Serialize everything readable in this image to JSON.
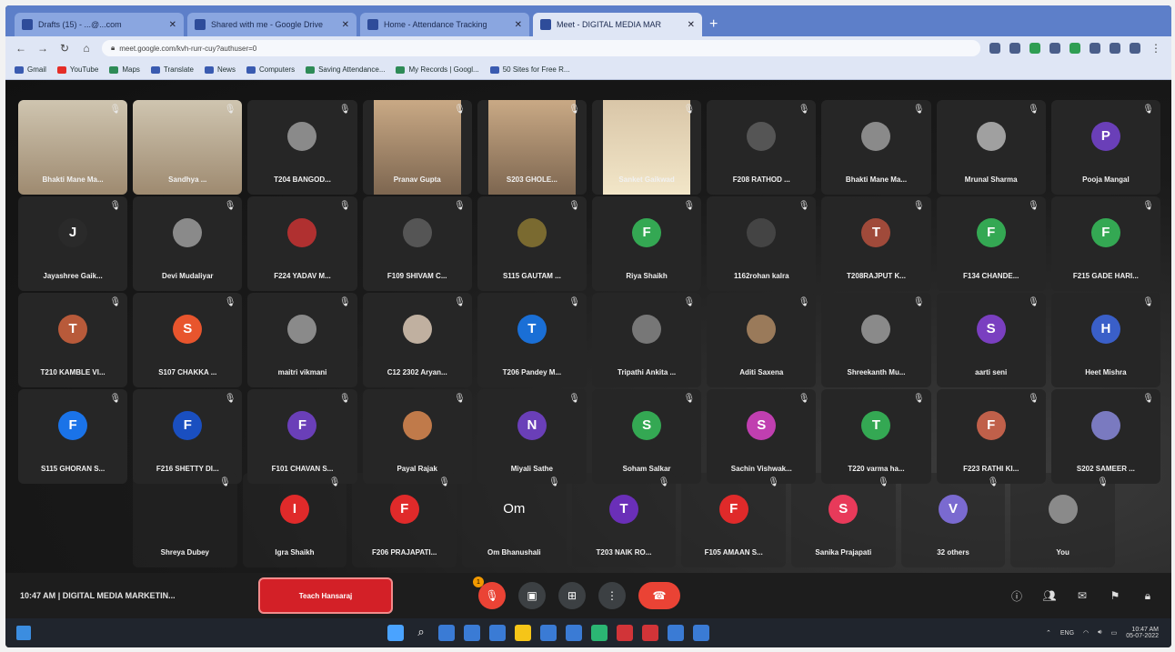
{
  "browser": {
    "tabs": [
      {
        "title": "Drafts (15) - ...@...com",
        "active": false
      },
      {
        "title": "Shared with me - Google Drive",
        "active": false
      },
      {
        "title": "Home - Attendance Tracking",
        "active": false
      },
      {
        "title": "Meet - DIGITAL MEDIA MAR",
        "active": true
      }
    ],
    "new_tab": "+",
    "url": "meet.google.com/kvh-rurr-cuy?authuser=0",
    "bookmarks": [
      "Gmail",
      "YouTube",
      "Maps",
      "Translate",
      "News",
      "Computers",
      "Saving Attendance...",
      "My Records | Googl...",
      "50 Sites for Free R..."
    ]
  },
  "participants_rows": [
    [
      {
        "name": "Bhakti Mane Ma...",
        "kind": "video",
        "style": "wide"
      },
      {
        "name": "Sandhya ...",
        "kind": "video",
        "style": "wide"
      },
      {
        "name": "T204 BANGOD...",
        "kind": "avatar",
        "letter": "",
        "color": "#8a8a8a"
      },
      {
        "name": "Pranav Gupta",
        "kind": "video",
        "style": "plain"
      },
      {
        "name": "S203 GHOLE...",
        "kind": "video",
        "style": "plain"
      },
      {
        "name": "Sanket Gaikwad",
        "kind": "video",
        "style": "face"
      },
      {
        "name": "F208 RATHOD ...",
        "kind": "avatar",
        "letter": "",
        "color": "#555555"
      },
      {
        "name": "Bhakti Mane Ma...",
        "kind": "avatar",
        "letter": "",
        "color": "#8a8a8a"
      },
      {
        "name": "Mrunal Sharma",
        "kind": "avatar",
        "letter": "",
        "color": "#a0a0a0"
      },
      {
        "name": "Pooja Mangal",
        "kind": "avatar",
        "letter": "P",
        "color": "#6a3fb8"
      }
    ],
    [
      {
        "name": "Jayashree Gaik...",
        "kind": "avatar",
        "letter": "J",
        "color": "#2a2a2a"
      },
      {
        "name": "Devi Mudaliyar",
        "kind": "avatar",
        "letter": "",
        "color": "#8a8a8a"
      },
      {
        "name": "F224 YADAV M...",
        "kind": "avatar",
        "letter": "",
        "color": "#b03030"
      },
      {
        "name": "F109 SHIVAM C...",
        "kind": "avatar",
        "letter": "",
        "color": "#555555"
      },
      {
        "name": "S115 GAUTAM ...",
        "kind": "avatar",
        "letter": "",
        "color": "#7a6a30"
      },
      {
        "name": "Riya Shaikh",
        "kind": "avatar",
        "letter": "F",
        "color": "#34a853"
      },
      {
        "name": "1162rohan kalra",
        "kind": "avatar",
        "letter": "",
        "color": "#444444"
      },
      {
        "name": "T208RAJPUT K...",
        "kind": "avatar",
        "letter": "T",
        "color": "#a04a3a"
      },
      {
        "name": "F134 CHANDE...",
        "kind": "avatar",
        "letter": "F",
        "color": "#34a853"
      },
      {
        "name": "F215 GADE HARI...",
        "kind": "avatar",
        "letter": "F",
        "color": "#34a853"
      }
    ],
    [
      {
        "name": "T210 KAMBLE VI...",
        "kind": "avatar",
        "letter": "T",
        "color": "#b85a3a"
      },
      {
        "name": "S107 CHAKKA ...",
        "kind": "avatar",
        "letter": "S",
        "color": "#e8552d"
      },
      {
        "name": "maitri vikmani",
        "kind": "avatar",
        "letter": "",
        "color": "#8a8a8a"
      },
      {
        "name": "C12 2302 Aryan...",
        "kind": "avatar",
        "letter": "",
        "color": "#c0b0a0"
      },
      {
        "name": "T206 Pandey M...",
        "kind": "avatar",
        "letter": "T",
        "color": "#1a6fd6"
      },
      {
        "name": "Tripathi Ankita ...",
        "kind": "avatar",
        "letter": "",
        "color": "#777777"
      },
      {
        "name": "Aditi Saxena",
        "kind": "avatar",
        "letter": "",
        "color": "#9a7a5a"
      },
      {
        "name": "Shreekanth Mu...",
        "kind": "avatar",
        "letter": "",
        "color": "#8a8a8a"
      },
      {
        "name": "aarti seni",
        "kind": "avatar",
        "letter": "S",
        "color": "#7a3fc0"
      },
      {
        "name": "Heet Mishra",
        "kind": "avatar",
        "letter": "H",
        "color": "#3a5fc8"
      }
    ],
    [
      {
        "name": "S115 GHORAN S...",
        "kind": "avatar",
        "letter": "F",
        "color": "#1a73e8"
      },
      {
        "name": "F216 SHETTY DI...",
        "kind": "avatar",
        "letter": "F",
        "color": "#1a4fc0"
      },
      {
        "name": "F101 CHAVAN S...",
        "kind": "avatar",
        "letter": "F",
        "color": "#6a3fb8"
      },
      {
        "name": "Payal Rajak",
        "kind": "avatar",
        "letter": "",
        "color": "#c07a4a"
      },
      {
        "name": "Miyali Sathe",
        "kind": "avatar",
        "letter": "N",
        "color": "#6a3fb8"
      },
      {
        "name": "Soham Salkar",
        "kind": "avatar",
        "letter": "S",
        "color": "#34a853"
      },
      {
        "name": "Sachin Vishwak...",
        "kind": "avatar",
        "letter": "S",
        "color": "#c03fb0"
      },
      {
        "name": "T220 varma ha...",
        "kind": "avatar",
        "letter": "T",
        "color": "#34a853"
      },
      {
        "name": "F223 RATHI KI...",
        "kind": "avatar",
        "letter": "F",
        "color": "#c0604a"
      },
      {
        "name": "S202 SAMEER ...",
        "kind": "avatar",
        "letter": "",
        "color": "#7a7ac0"
      }
    ]
  ],
  "participants_row5": [
    {
      "name": "Shreya Dubey",
      "kind": "avatar",
      "letter": "",
      "color": "transparent"
    },
    {
      "name": "Igra Shaikh",
      "kind": "avatar",
      "letter": "I",
      "color": "#e02a2a"
    },
    {
      "name": "F206 PRAJAPATI...",
      "kind": "avatar",
      "letter": "F",
      "color": "#e02a2a"
    },
    {
      "name": "Om Bhanushali",
      "kind": "text",
      "letter": "Om",
      "color": "transparent"
    },
    {
      "name": "T203 NAIK RO...",
      "kind": "avatar",
      "letter": "T",
      "color": "#6a2fb8"
    },
    {
      "name": "F105 AMAAN S...",
      "kind": "avatar",
      "letter": "F",
      "color": "#e02a2a"
    },
    {
      "name": "Sanika Prajapati",
      "kind": "avatar",
      "letter": "S",
      "color": "#e83a5a"
    },
    {
      "name": "32 others",
      "kind": "avatar",
      "letter": "V",
      "color": "#7a6ad0"
    },
    {
      "name": "You",
      "kind": "avatar",
      "letter": "",
      "color": "#8a8a8a"
    }
  ],
  "controls": {
    "time": "10:47 AM",
    "separator": "|",
    "meeting_title": "DIGITAL MEDIA MARKETIN...",
    "presenting_label": "Teach Hansaraj",
    "notification_count": "1",
    "center_icons": [
      "mic-off",
      "captions",
      "present-screen",
      "more-options",
      "end-call"
    ],
    "right_icons": [
      "info",
      "people",
      "chat",
      "activities",
      "host-controls"
    ]
  },
  "taskbar": {
    "date": "05-07-2022",
    "time": "10:47 AM",
    "lang": "ENG"
  }
}
